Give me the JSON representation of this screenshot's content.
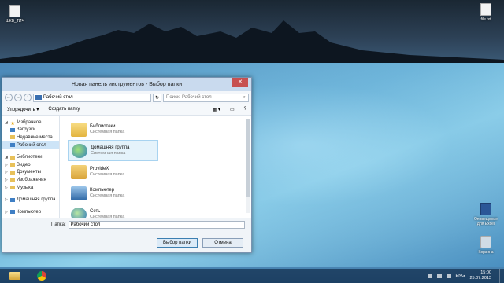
{
  "desktop": {
    "icons": [
      {
        "label": "ШКВ_ТИЧ"
      },
      {
        "label": "file.txt"
      },
      {
        "label": "Оповещение для Excel"
      },
      {
        "label": "Корзина"
      }
    ]
  },
  "dialog": {
    "title": "Новая панель инструментов - Выбор папки",
    "address": "Рабочий стол",
    "search_placeholder": "Поиск: Рабочий стол",
    "toolbar": {
      "organize_label": "Упорядочить ▾",
      "new_folder_label": "Создать папку"
    },
    "nav": {
      "favorites_label": "Избранное",
      "downloads_label": "Загрузки",
      "recent_label": "Недавние места",
      "desktop_label": "Рабочий стол",
      "libraries_label": "Библиотеки",
      "video_label": "Видео",
      "documents_label": "Документы",
      "pictures_label": "Изображения",
      "music_label": "Музыка",
      "homegroup_label": "Домашняя группа",
      "computer_label": "Компьютер"
    },
    "files": [
      {
        "name": "Библиотеки",
        "sub": "Системная папка",
        "icon": "libraries-folder-icon"
      },
      {
        "name": "Домашняя группа",
        "sub": "Системная папка",
        "icon": "homegroup-icon"
      },
      {
        "name": "ProvideX",
        "sub": "Системная папка",
        "icon": "user-folder-icon"
      },
      {
        "name": "Компьютер",
        "sub": "Системная папка",
        "icon": "computer-icon"
      },
      {
        "name": "Сеть",
        "sub": "Системная папка",
        "icon": "network-icon"
      }
    ],
    "folder_label": "Папка:",
    "folder_value": "Рабочий стол",
    "select_button": "Выбор папки",
    "cancel_button": "Отмена"
  },
  "taskbar": {
    "lang": "ENG",
    "time": "15:00",
    "date": "25.07.2013"
  }
}
